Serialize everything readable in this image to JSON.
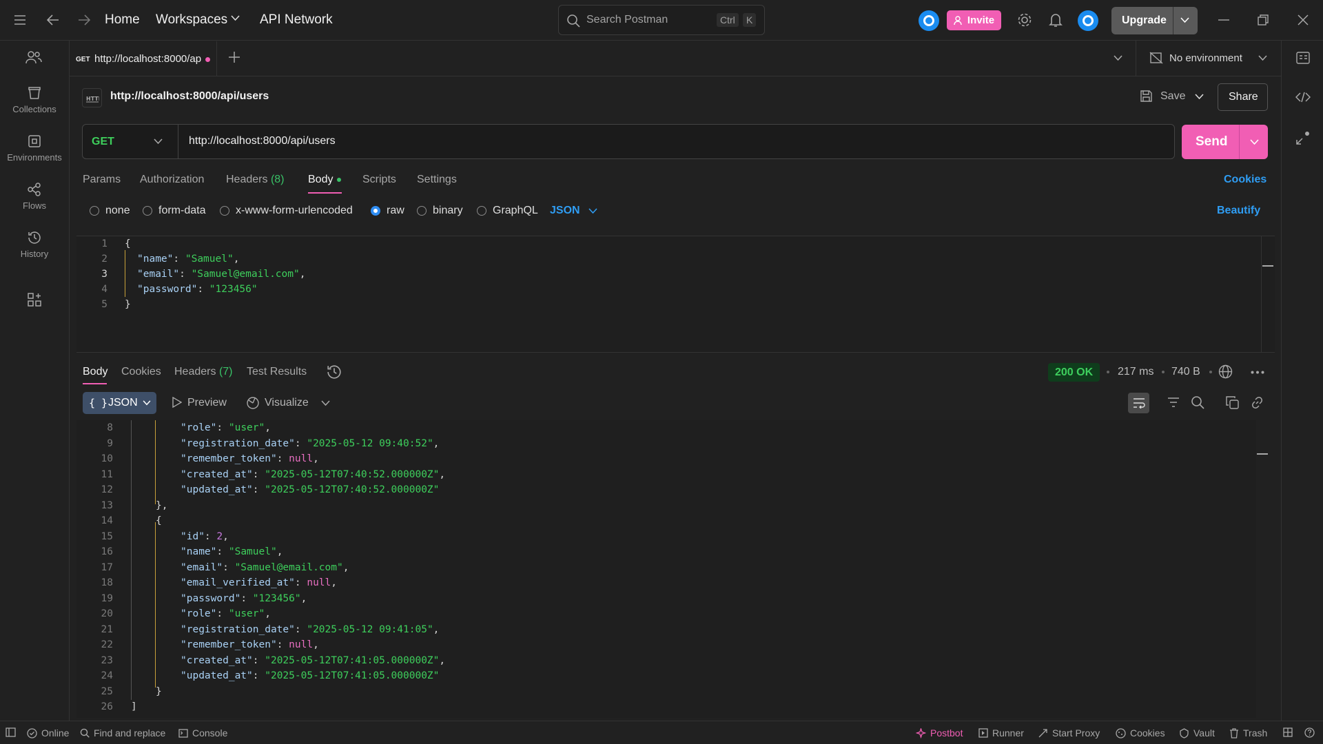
{
  "topbar": {
    "nav": {
      "home": "Home",
      "workspaces": "Workspaces",
      "api_network": "API Network"
    },
    "search": {
      "placeholder": "Search Postman",
      "kbd1": "Ctrl",
      "kbd2": "K"
    },
    "invite": "Invite",
    "upgrade": "Upgrade"
  },
  "sidebar": {
    "items": [
      {
        "label": "Collections",
        "icon": "trash-can-icon"
      },
      {
        "label": "Environments",
        "icon": "environment-icon"
      },
      {
        "label": "Flows",
        "icon": "flows-icon"
      },
      {
        "label": "History",
        "icon": "history-icon"
      }
    ]
  },
  "tabbar": {
    "tab": {
      "method": "GET",
      "title": "http://localhost:8000/ap"
    },
    "environment": "No environment"
  },
  "request": {
    "title": "http://localhost:8000/api/users",
    "save": "Save",
    "share": "Share",
    "method": "GET",
    "url": "http://localhost:8000/api/users",
    "send": "Send",
    "tabs": {
      "params": "Params",
      "authorization": "Authorization",
      "headers": "Headers",
      "headers_count": "(8)",
      "body": "Body",
      "scripts": "Scripts",
      "settings": "Settings"
    },
    "cookies": "Cookies",
    "body_types": {
      "none": "none",
      "form_data": "form-data",
      "urlencoded": "x-www-form-urlencoded",
      "raw": "raw",
      "binary": "binary",
      "graphql": "GraphQL"
    },
    "format": "JSON",
    "beautify": "Beautify",
    "line_numbers": [
      "1",
      "2",
      "3",
      "4",
      "5"
    ],
    "body_lines": {
      "l1": "{",
      "l2_key": "\"name\"",
      "l2_val": "\"Samuel\"",
      "l3_key": "\"email\"",
      "l3_val": "\"Samuel@email.com\"",
      "l4_key": "\"password\"",
      "l4_val": "\"123456\"",
      "l5": "}"
    }
  },
  "response": {
    "tabs": {
      "body": "Body",
      "cookies": "Cookies",
      "headers": "Headers",
      "headers_count": "(7)",
      "test_results": "Test Results"
    },
    "status": "200 OK",
    "time": "217 ms",
    "size": "740 B",
    "view": {
      "format": "JSON",
      "preview": "Preview",
      "visualize": "Visualize"
    },
    "line_numbers": [
      "8",
      "9",
      "10",
      "11",
      "12",
      "13",
      "14",
      "15",
      "16",
      "17",
      "18",
      "19",
      "20",
      "21",
      "22",
      "23",
      "24",
      "25",
      "26"
    ],
    "lines": {
      "l8_key": "\"role\"",
      "l8_val": "\"user\"",
      "l9_key": "\"registration_date\"",
      "l9_val": "\"2025-05-12 09:40:52\"",
      "l10_key": "\"remember_token\"",
      "l10_val": "null",
      "l11_key": "\"created_at\"",
      "l11_val": "\"2025-05-12T07:40:52.000000Z\"",
      "l12_key": "\"updated_at\"",
      "l12_val": "\"2025-05-12T07:40:52.000000Z\"",
      "l13": "},",
      "l14": "{",
      "l15_key": "\"id\"",
      "l15_val": "2",
      "l16_key": "\"name\"",
      "l16_val": "\"Samuel\"",
      "l17_key": "\"email\"",
      "l17_val": "\"Samuel@email.com\"",
      "l18_key": "\"email_verified_at\"",
      "l18_val": "null",
      "l19_key": "\"password\"",
      "l19_val": "\"123456\"",
      "l20_key": "\"role\"",
      "l20_val": "\"user\"",
      "l21_key": "\"registration_date\"",
      "l21_val": "\"2025-05-12 09:41:05\"",
      "l22_key": "\"remember_token\"",
      "l22_val": "null",
      "l23_key": "\"created_at\"",
      "l23_val": "\"2025-05-12T07:41:05.000000Z\"",
      "l24_key": "\"updated_at\"",
      "l24_val": "\"2025-05-12T07:41:05.000000Z\"",
      "l25": "}",
      "l26": "]"
    }
  },
  "statusbar": {
    "online": "Online",
    "find_replace": "Find and replace",
    "console": "Console",
    "postbot": "Postbot",
    "runner": "Runner",
    "start_proxy": "Start Proxy",
    "cookies": "Cookies",
    "vault": "Vault",
    "trash": "Trash"
  },
  "colors": {
    "accent": "#f15eb4",
    "link": "#2f9df3",
    "success": "#3ed05e",
    "bg": "#212121"
  }
}
